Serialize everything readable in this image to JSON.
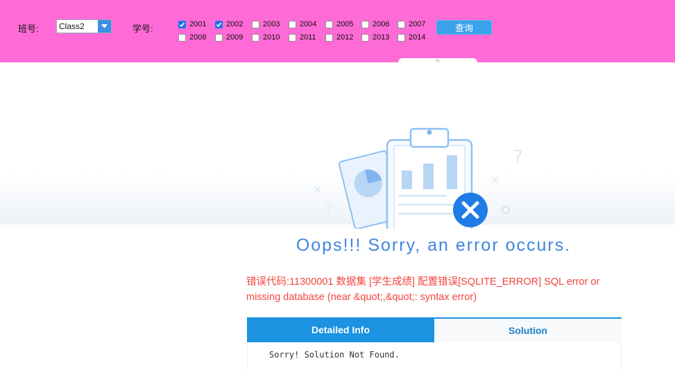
{
  "toolbar": {
    "class_label": "班号:",
    "class_select_value": "Class2",
    "student_label": "学号:",
    "student_ids": [
      {
        "id": "2001",
        "checked": true
      },
      {
        "id": "2002",
        "checked": true
      },
      {
        "id": "2003",
        "checked": false
      },
      {
        "id": "2004",
        "checked": false
      },
      {
        "id": "2005",
        "checked": false
      },
      {
        "id": "2006",
        "checked": false
      },
      {
        "id": "2007",
        "checked": false
      },
      {
        "id": "2008",
        "checked": false
      },
      {
        "id": "2009",
        "checked": false
      },
      {
        "id": "2010",
        "checked": false
      },
      {
        "id": "2011",
        "checked": false
      },
      {
        "id": "2012",
        "checked": false
      },
      {
        "id": "2013",
        "checked": false
      },
      {
        "id": "2014",
        "checked": false
      }
    ],
    "query_label": "查询"
  },
  "error_page": {
    "title": "Oops!!! Sorry, an error occurs.",
    "message": "错误代码:11300001 数据集 [学生成绩] 配置错误[SQLITE_ERROR] SQL error or missing database (near &quot;,&quot;: syntax error)",
    "tabs": [
      {
        "label": "Detailed Info",
        "active": true
      },
      {
        "label": "Solution",
        "active": false
      }
    ],
    "panel_message": "Sorry! Solution Not Found."
  },
  "colors": {
    "toolbar_bg": "#ff6bd6",
    "accent": "#1c92e0",
    "title": "#3e86df",
    "error_text": "#f2453d"
  },
  "icons": {
    "select_arrow": "chevron-down-icon",
    "illustration": "clipboard-error-icon"
  }
}
